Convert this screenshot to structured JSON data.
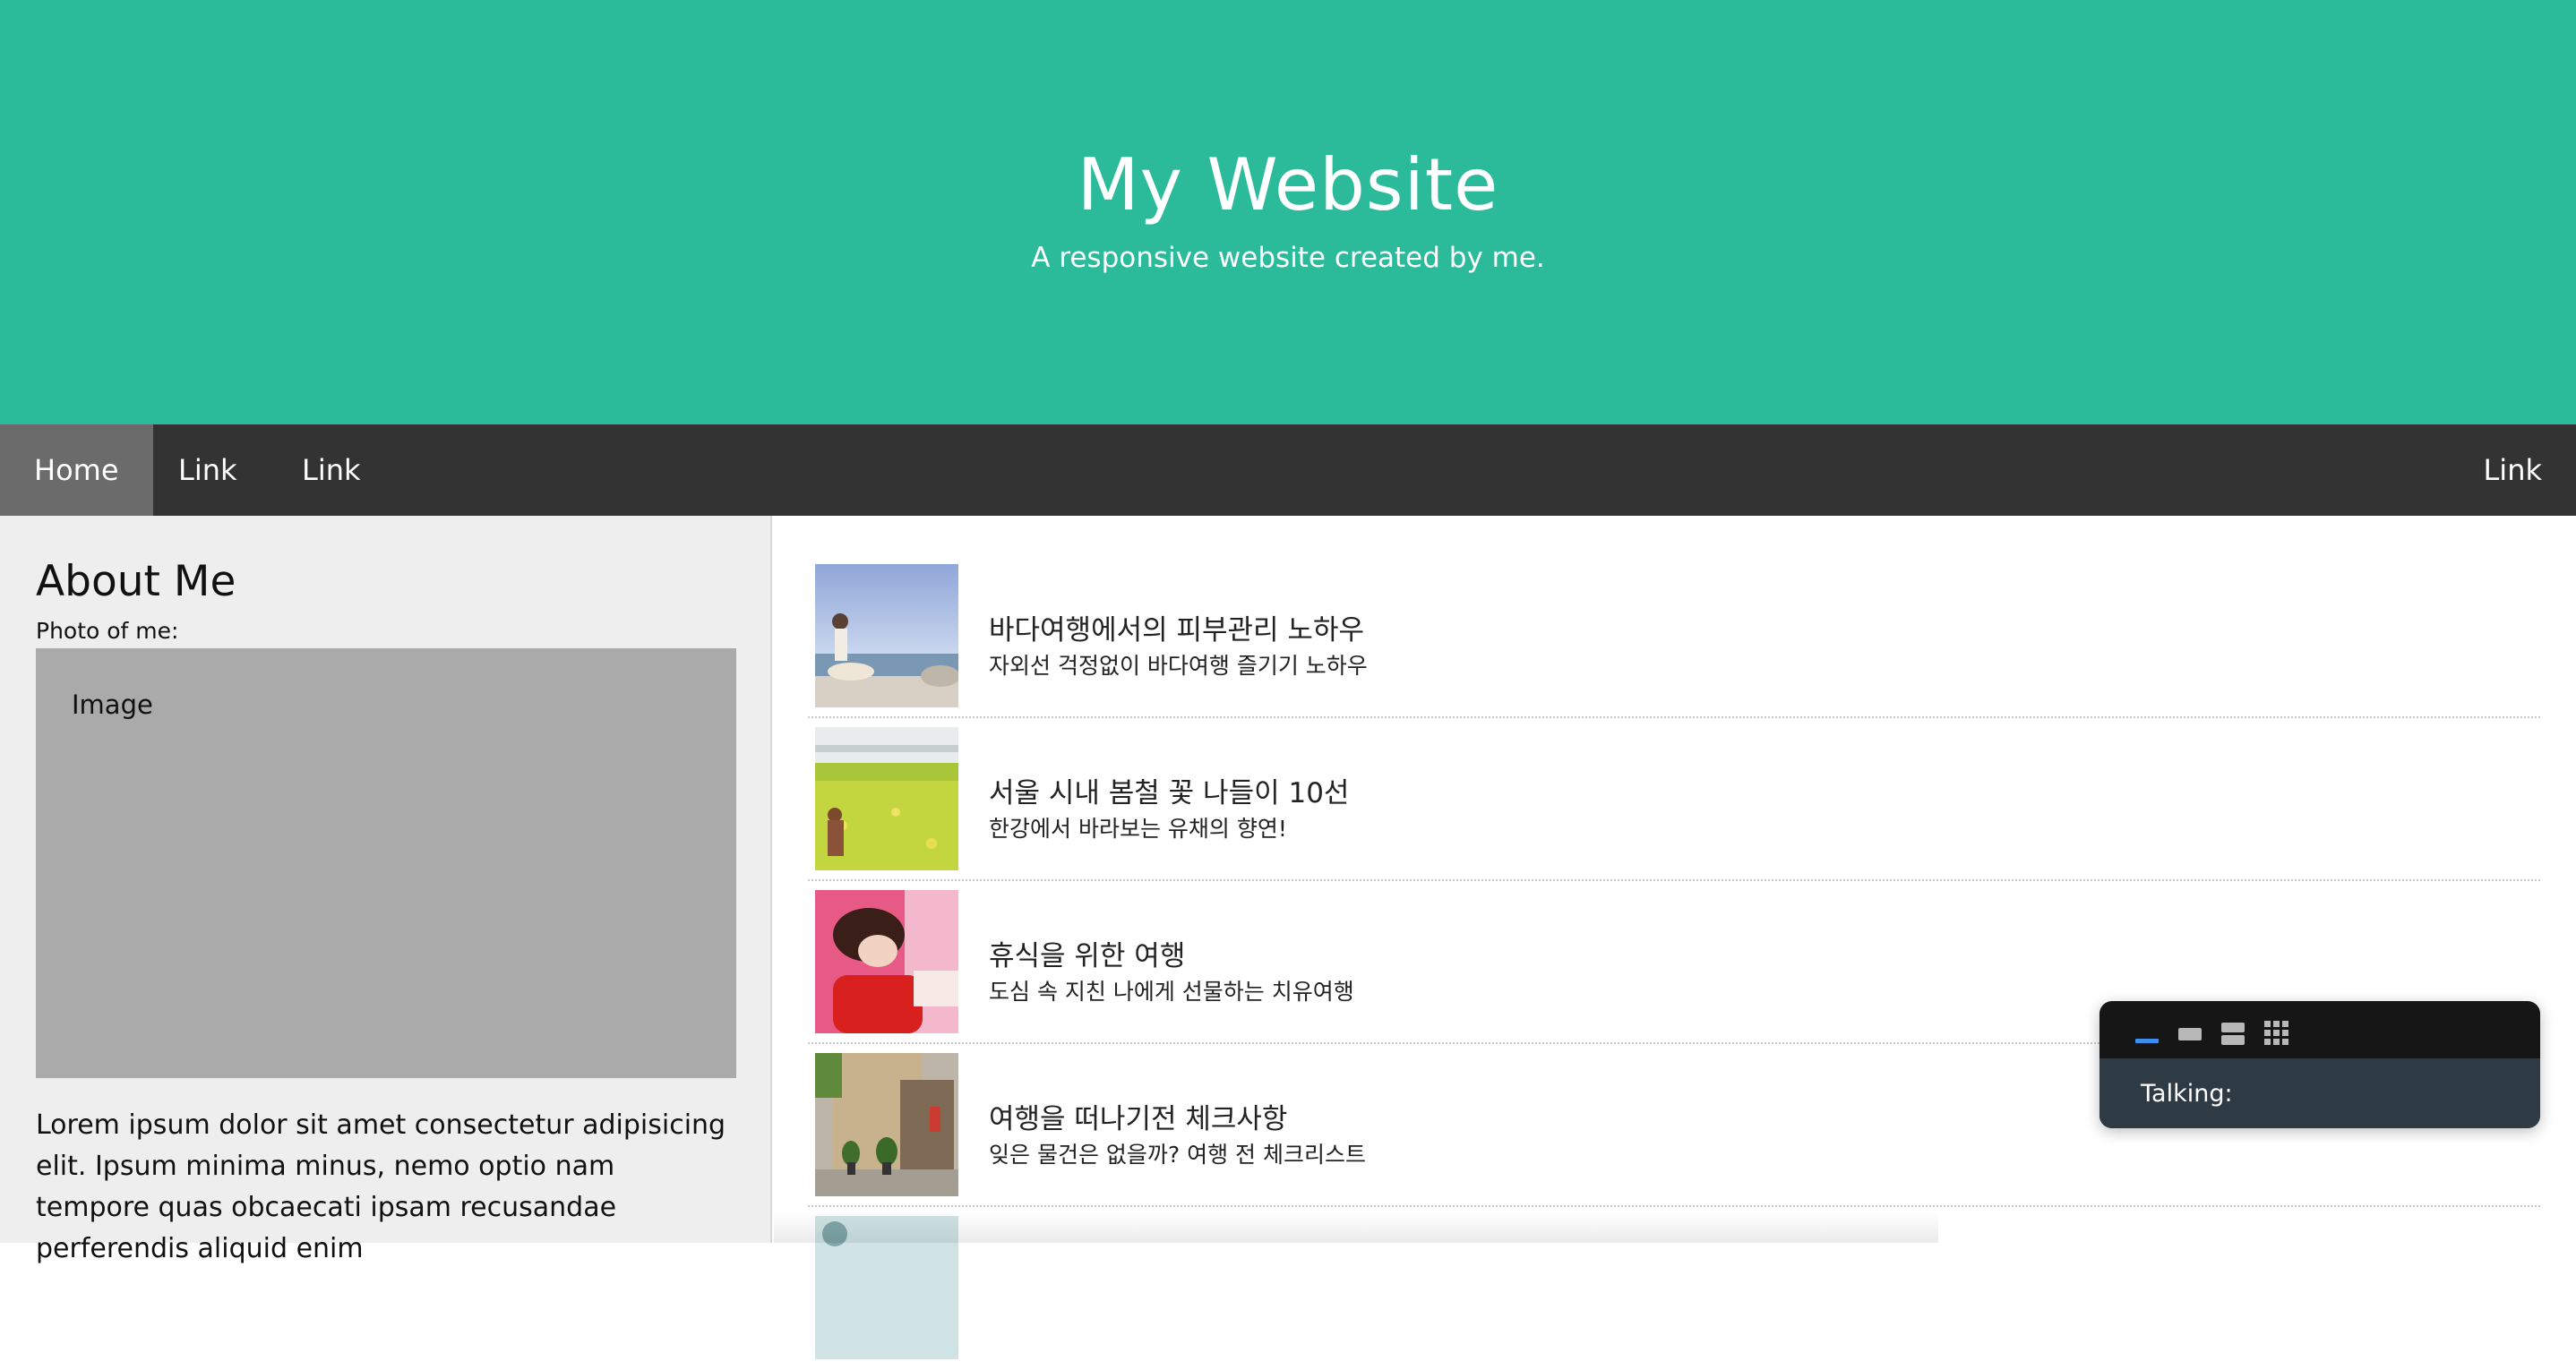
{
  "colors": {
    "header_bg": "#2bbb9b",
    "nav_bg": "#333333",
    "nav_active_bg": "#6b6b6b",
    "sidebar_bg": "#eeeeee",
    "image_placeholder_bg": "#aaaaaa",
    "widget_bg": "#161616",
    "widget_body_bg": "#2e3a44",
    "widget_accent": "#3d8ef0"
  },
  "header": {
    "title": "My Website",
    "subtitle": "A responsive website created by me."
  },
  "nav": {
    "items": [
      {
        "label": "Home",
        "active": true
      },
      {
        "label": "Link",
        "active": false
      },
      {
        "label": "Link",
        "active": false
      }
    ],
    "right_item": {
      "label": "Link"
    }
  },
  "sidebar": {
    "title": "About Me",
    "photo_label": "Photo of me:",
    "image_placeholder": "Image",
    "lorem": "Lorem ipsum dolor sit amet consectetur adipisicing elit. Ipsum minima minus, nemo optio nam tempore quas obcaecati ipsam recusandae perferendis aliquid enim"
  },
  "articles": [
    {
      "title": "바다여행에서의 피부관리 노하우",
      "desc": "자외선 걱정없이 바다여행 즐기기 노하우",
      "thumb_icon": "beach-photo"
    },
    {
      "title": "서울 시내 봄철 꽃 나들이 10선",
      "desc": "한강에서 바라보는 유채의 향연!",
      "thumb_icon": "flower-field-photo"
    },
    {
      "title": "휴식을 위한 여행",
      "desc": "도심 속 지친 나에게 선물하는 치유여행",
      "thumb_icon": "resting-woman-photo"
    },
    {
      "title": "여행을 떠나기전 체크사항",
      "desc": "잊은 물건은 없을까? 여행 전 체크리스트",
      "thumb_icon": "building-plants-photo"
    },
    {
      "title": "",
      "desc": "",
      "thumb_icon": "partial-photo"
    }
  ],
  "widget": {
    "label": "Talking:",
    "tools": [
      "minimize-icon",
      "small-view-icon",
      "split-view-icon",
      "grid-view-icon"
    ]
  }
}
